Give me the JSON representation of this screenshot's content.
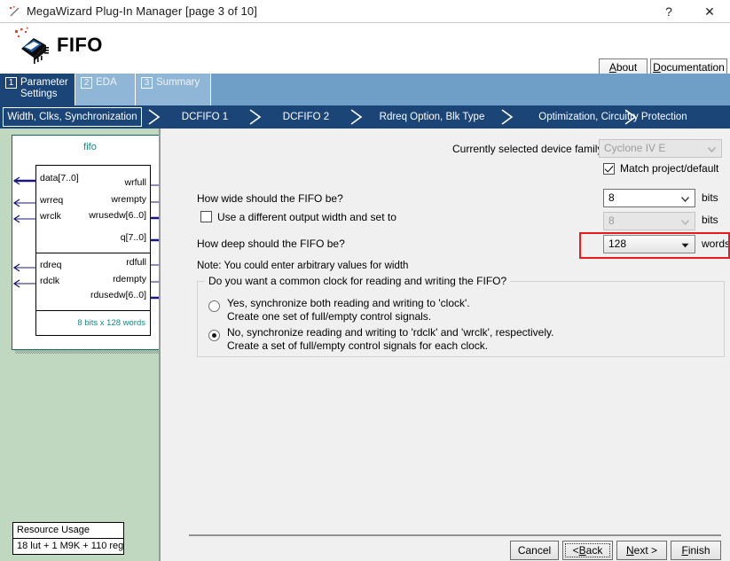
{
  "window": {
    "title": "MegaWizard Plug-In Manager [page 3 of 10]",
    "icon": "wizard-wand-icon",
    "help_label": "?",
    "close_label": "✕"
  },
  "header": {
    "logo_icon": "fifo-chip-icon",
    "title": "FIFO",
    "about_label": "About",
    "about_mnemonic": "A",
    "documentation_label": "Documentation",
    "documentation_mnemonic": "D"
  },
  "tabs": [
    {
      "num": "1",
      "label_line1": "Parameter",
      "label_line2": "Settings",
      "active": true
    },
    {
      "num": "2",
      "label_line1": "EDA",
      "label_line2": "",
      "active": false
    },
    {
      "num": "3",
      "label_line1": "Summary",
      "label_line2": "",
      "active": false
    }
  ],
  "breadcrumbs": [
    {
      "label": "Width, Clks, Synchronization",
      "current": true
    },
    {
      "label": "DCFIFO 1",
      "current": false
    },
    {
      "label": "DCFIFO 2",
      "current": false
    },
    {
      "label": "Rdreq Option, Blk Type",
      "current": false
    },
    {
      "label": "Optimization, Circuitry Protection",
      "current": false
    }
  ],
  "diagram": {
    "title": "fifo",
    "inputs_top": [
      "data[7..0]",
      "wrreq",
      "wrclk"
    ],
    "inputs_bottom": [
      "rdreq",
      "rdclk"
    ],
    "outputs_top": [
      "wrfull",
      "wrempty",
      "wrusedw[6..0]"
    ],
    "outputs_bottom": [
      "q[7..0]",
      "rdfull",
      "rdempty",
      "rdusedw[6..0]"
    ],
    "size_note": "8 bits x 128 words"
  },
  "resource_usage": {
    "header": "Resource Usage",
    "value": "18 lut + 1 M9K + 110 reg"
  },
  "form": {
    "device_family_label": "Currently selected device family:",
    "device_family_value": "Cyclone IV E",
    "match_project_label": "Match project/default",
    "match_project_checked": true,
    "width_question": "How wide should the FIFO be?",
    "width_value": "8",
    "width_unit": "bits",
    "output_width_label": "Use a different output width and set to",
    "output_width_checked": false,
    "output_width_value": "8",
    "output_width_unit": "bits",
    "depth_question": "How deep should the FIFO be?",
    "depth_value": "128",
    "depth_unit": "words",
    "note": "Note: You could enter arbitrary values for width",
    "clock_group_title": "Do you want a common clock for reading and writing the FIFO?",
    "clock_options": [
      {
        "line1": "Yes, synchronize both reading and writing to 'clock'.",
        "line2": "Create one set of full/empty control signals.",
        "selected": false
      },
      {
        "line1": "No, synchronize reading and writing to 'rdclk' and 'wrclk', respectively.",
        "line2": "Create a set of full/empty control signals for each clock.",
        "selected": true
      }
    ]
  },
  "footer": {
    "cancel_label": "Cancel",
    "back_label": "< Back",
    "back_mnemonic": "B",
    "next_label": "Next >",
    "next_mnemonic": "N",
    "finish_label": "Finish",
    "finish_mnemonic": "F"
  },
  "colors": {
    "tab_active": "#1b4477",
    "tab_inactive": "#8fb6d6",
    "breadcrumb_bar": "#1b4477",
    "panel_green": "#bfd8bf",
    "annotation_red": "#e81c1c",
    "diagram_teal": "#0f8a8a"
  }
}
